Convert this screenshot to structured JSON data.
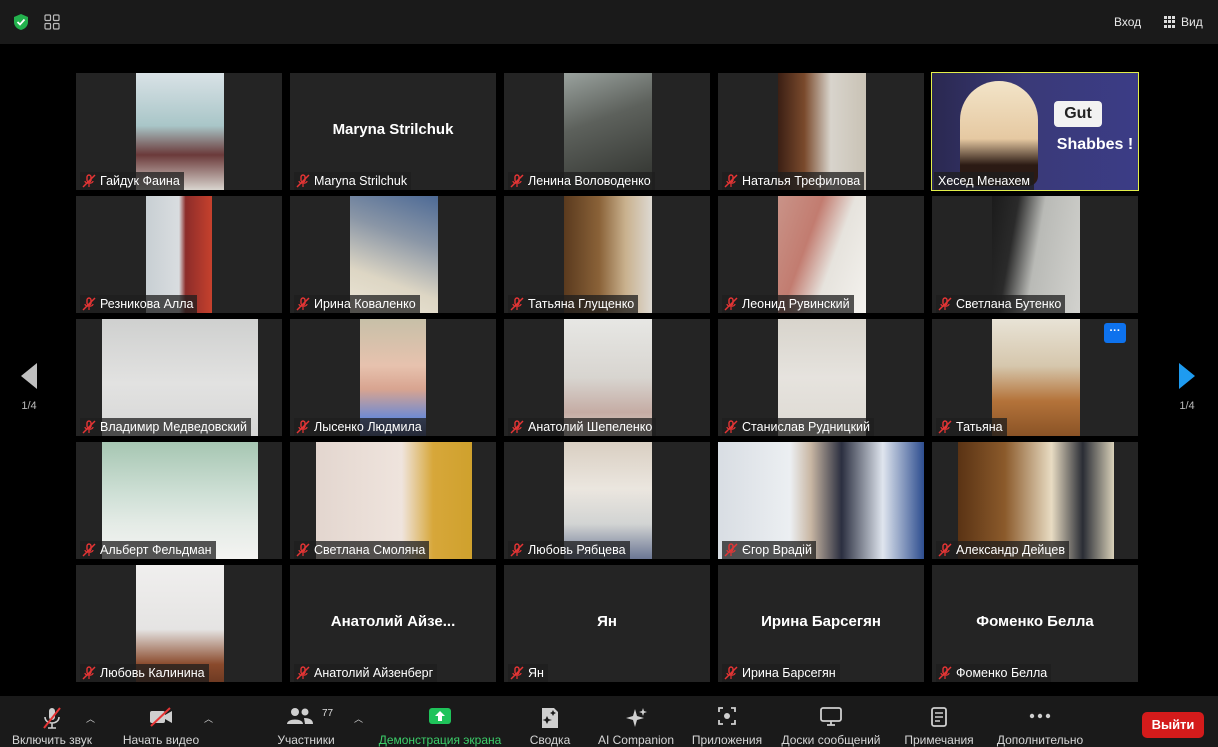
{
  "topbar": {
    "login_label": "Вход",
    "view_label": "Вид"
  },
  "navigation": {
    "left_page": "1/4",
    "right_page": "1/4"
  },
  "participants": [
    {
      "name": "Гайдук Фаина"
    },
    {
      "name": "Maryna Strilchuk",
      "big_name": "Maryna Strilchuk"
    },
    {
      "name": "Ленина Воловоденко"
    },
    {
      "name": "Наталья Трефилова"
    },
    {
      "name": "Хесед Менахем",
      "active": true,
      "video_text_1": "Gut",
      "video_text_2": "Shabbes !"
    },
    {
      "name": "Резникова Алла"
    },
    {
      "name": "Ирина Коваленко"
    },
    {
      "name": "Татьяна Глущенко"
    },
    {
      "name": "Леонид Рувинский"
    },
    {
      "name": "Светлана Бутенко"
    },
    {
      "name": "Владимир Медведовский"
    },
    {
      "name": "Лысенко Людмила"
    },
    {
      "name": "Анатолий Шепеленко"
    },
    {
      "name": "Станислав Рудницкий"
    },
    {
      "name": "Татьяна",
      "more_label": "···"
    },
    {
      "name": "Альберт Фельдман"
    },
    {
      "name": "Светлана Смоляна"
    },
    {
      "name": "Любовь Рябцева"
    },
    {
      "name": "Єгор Врадій"
    },
    {
      "name": "Александр Дейцев"
    },
    {
      "name": "Любовь Калинина"
    },
    {
      "name": "Анатолий Айзенберг",
      "big_name": "Анатолий  Айзе..."
    },
    {
      "name": "Ян",
      "big_name": "Ян"
    },
    {
      "name": "Ирина Барсегян",
      "big_name": "Ирина Барсегян"
    },
    {
      "name": "Фоменко Белла",
      "big_name": "Фоменко Белла"
    }
  ],
  "toolbar": {
    "unmute": "Включить звук",
    "start_video": "Начать видео",
    "participants": "Участники",
    "participants_count": "77",
    "share_screen": "Демонстрация экрана",
    "summary": "Сводка",
    "ai_companion": "AI Companion",
    "apps": "Приложения",
    "whiteboards": "Доски сообщений",
    "notes": "Примечания",
    "more": "Дополнительно",
    "leave": "Выйти"
  },
  "colors": {
    "active_speaker": "#e3ef4a",
    "share_green": "#3ccf6a",
    "leave_red": "#d41b1b",
    "more_blue": "#0e72ed"
  }
}
